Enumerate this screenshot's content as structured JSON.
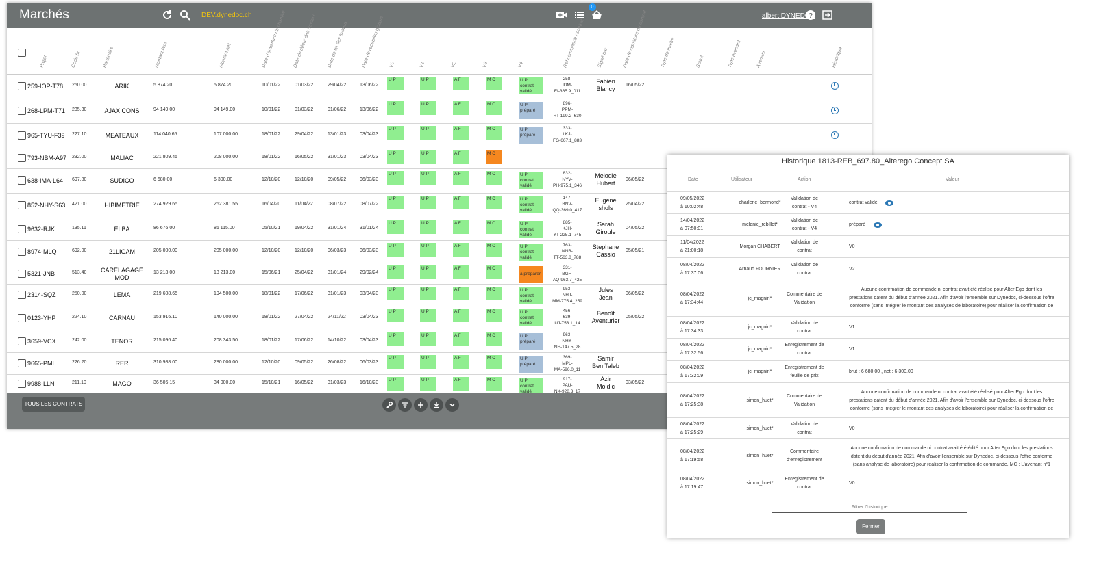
{
  "app": {
    "title": "Marchés",
    "env_link": "DEV.dynedoc.ch",
    "list_badge": "0",
    "user": "albert DYNEDOC",
    "accent_color": "#f1c40f",
    "icons": [
      "refresh-icon",
      "search-icon",
      "video-add-icon",
      "list-icon",
      "basket-icon",
      "help-icon",
      "logout-icon"
    ]
  },
  "table": {
    "columns": [
      "Projet",
      "Code bt",
      "Partenaire",
      "Montant brut",
      "Montant net",
      "Date d'ouverture du chantier",
      "Date de début des travaux",
      "Date de fin des travaux",
      "Date de réception globale",
      "V0",
      "V1",
      "V2",
      "V3",
      "V4",
      "Ref commande / contrat",
      "Signé par",
      "Date de signature du contrat",
      "Type de maître",
      "Statut",
      "Type avenant",
      "Avenant",
      "Historique"
    ],
    "rows": [
      {
        "projet": "259-IOP-T78",
        "code": "250.00",
        "partenaire": "ARIK",
        "brut": "5 874.20",
        "net": "5 874.20",
        "d1": "10/01/22",
        "d2": "01/03/22",
        "d3": "29/04/22",
        "d4": "13/06/22",
        "v0": "U P",
        "v0b": true,
        "v1": "U P",
        "v1b": false,
        "v2": "A F",
        "v3": "M C",
        "v3o": false,
        "v3b": false,
        "v4": [
          "U P",
          "contrat",
          "validé"
        ],
        "v4c": "green",
        "ref": [
          "258-",
          "IDM-",
          "EI-365.9_011"
        ],
        "signe": [
          "Fabien",
          "Blancy"
        ],
        "dsig": "16/05/22",
        "hist": true
      },
      {
        "projet": "268-LPM-T71",
        "code": "235.30",
        "partenaire": "AJAX CONS",
        "brut": "94 149.00",
        "net": "94 149.00",
        "d1": "10/01/22",
        "d2": "01/03/22",
        "d3": "01/06/22",
        "d4": "13/06/22",
        "v0": "U P",
        "v0b": true,
        "v1": "U P",
        "v1b": false,
        "v2": "A F",
        "v3": "M C",
        "v3o": false,
        "v3b": false,
        "v4": [
          "U P",
          "préparé"
        ],
        "v4c": "blue",
        "ref": [
          "896-",
          "PPM-",
          "RT-199.2_630"
        ],
        "signe": [],
        "dsig": "",
        "hist": true
      },
      {
        "projet": "965-TYU-F39",
        "code": "227.10",
        "partenaire": "MEATEAUX",
        "brut": "114 040.65",
        "net": "107 000.00",
        "d1": "18/01/22",
        "d2": "29/04/22",
        "d3": "13/01/23",
        "d4": "03/04/23",
        "v0": "U P",
        "v0b": true,
        "v1": "U P",
        "v1b": false,
        "v2": "A F",
        "v3": "M C",
        "v3o": false,
        "v3b": false,
        "v4": [
          "U P",
          "préparé"
        ],
        "v4c": "blue",
        "ref": [
          "333-",
          "LKJ-",
          "FG-667.1_883"
        ],
        "signe": [],
        "dsig": "",
        "hist": true
      },
      {
        "projet": "793-NBM-A97",
        "code": "232.00",
        "partenaire": "MALIAC",
        "brut": "221 809.45",
        "net": "208 000.00",
        "d1": "18/01/22",
        "d2": "16/05/22",
        "d3": "31/01/23",
        "d4": "03/04/23",
        "v0": "U P",
        "v0b": false,
        "v1": "U P",
        "v1b": true,
        "v2": "A F",
        "v3": "M C",
        "v3o": true,
        "v3b": true,
        "v4": [],
        "v4c": "",
        "ref": [],
        "signe": [],
        "dsig": "",
        "hist": false
      },
      {
        "projet": "638-IMA-L64",
        "code": "697.80",
        "partenaire": "SUDICO",
        "brut": "6 680.00",
        "net": "6 300.00",
        "d1": "12/10/20",
        "d2": "12/10/20",
        "d3": "09/05/22",
        "d4": "06/03/23",
        "v0": "U P",
        "v0b": true,
        "v1": "U P",
        "v1b": true,
        "v2": "A F",
        "v3": "M C",
        "v3o": false,
        "v3b": false,
        "v4": [
          "U P",
          "contrat",
          "validé"
        ],
        "v4c": "green",
        "ref": [
          "832-",
          "NYV-",
          "PH-975.1_346"
        ],
        "signe": [
          "Melodie",
          "Hubert"
        ],
        "dsig": "06/05/22",
        "hist": false
      },
      {
        "projet": "852-NHY-S63",
        "code": "421.00",
        "partenaire": "HIBIMETRIE",
        "brut": "274 929.65",
        "net": "262 381.55",
        "d1": "16/04/20",
        "d2": "11/04/22",
        "d3": "08/07/22",
        "d4": "08/07/22",
        "v0": "U P",
        "v0b": true,
        "v1": "U P",
        "v1b": true,
        "v2": "A F",
        "v3": "M C",
        "v3o": false,
        "v3b": false,
        "v4": [
          "U P",
          "contrat",
          "validé"
        ],
        "v4c": "green",
        "ref": [
          "147-",
          "BNV-",
          "QQ-369.0_417"
        ],
        "signe": [
          "Eugene",
          "shols"
        ],
        "dsig": "25/04/22",
        "hist": false
      },
      {
        "projet": "9632-RJK",
        "code": "135.11",
        "partenaire": "ELBA",
        "brut": "86 676.00",
        "net": "86 115.00",
        "d1": "05/10/21",
        "d2": "19/04/22",
        "d3": "31/01/24",
        "d4": "31/01/24",
        "v0": "U P",
        "v0b": true,
        "v1": "U P",
        "v1b": false,
        "v2": "A F",
        "v3": "M C",
        "v3o": false,
        "v3b": false,
        "v4": [
          "U P",
          "contrat",
          "validé"
        ],
        "v4c": "green",
        "ref": [
          "885-",
          "KJH-",
          "YT-225.1_745"
        ],
        "signe": [
          "Sarah",
          "Giroule"
        ],
        "dsig": "04/05/22",
        "hist": false
      },
      {
        "projet": "8974-MLQ",
        "code": "692.00",
        "partenaire": "21LIGAM",
        "brut": "205 000.00",
        "net": "205 000.00",
        "d1": "12/10/20",
        "d2": "12/10/20",
        "d3": "06/03/23",
        "d4": "06/03/23",
        "v0": "U P",
        "v0b": true,
        "v1": "U P",
        "v1b": false,
        "v2": "A F",
        "v3": "M C",
        "v3o": false,
        "v3b": false,
        "v4": [
          "U P",
          "contrat",
          "validé"
        ],
        "v4c": "green",
        "ref": [
          "763-",
          "NNB-",
          "TT-563.8_788"
        ],
        "signe": [
          "Stephane",
          "Cassio"
        ],
        "dsig": "05/05/21",
        "hist": false
      },
      {
        "projet": "5321-JNB",
        "code": "513.40",
        "partenaire": "CARELAGAGE MOD",
        "brut": "13 213.00",
        "net": "13 213.00",
        "d1": "15/06/21",
        "d2": "25/04/22",
        "d3": "31/01/24",
        "d4": "29/02/24",
        "v0": "U P",
        "v0b": true,
        "v1": "U P",
        "v1b": true,
        "v2": "A F",
        "v3": "M C",
        "v3o": false,
        "v3b": false,
        "v4": [
          "à préparer"
        ],
        "v4c": "orange",
        "ref": [
          "331-",
          "BGF-",
          "AQ-963.7_425"
        ],
        "signe": [],
        "dsig": "",
        "hist": false
      },
      {
        "projet": "2314-SQZ",
        "code": "250.00",
        "partenaire": "LEMA",
        "brut": "219 608.65",
        "net": "194 500.00",
        "d1": "18/01/22",
        "d2": "17/06/22",
        "d3": "31/01/23",
        "d4": "03/04/23",
        "v0": "U P",
        "v0b": true,
        "v1": "U P",
        "v1b": true,
        "v2": "A F",
        "v3": "M C",
        "v3o": false,
        "v3b": false,
        "v4": [
          "U P",
          "contrat",
          "validé"
        ],
        "v4c": "green",
        "ref": [
          "953-",
          "NHJ-",
          "MM-775.4_259"
        ],
        "signe": [
          "Jules",
          "Jean"
        ],
        "dsig": "06/05/22",
        "hist": false
      },
      {
        "projet": "0123-YHP",
        "code": "224.10",
        "partenaire": "CARNAU",
        "brut": "153 916.10",
        "net": "140 000.00",
        "d1": "18/01/22",
        "d2": "27/04/22",
        "d3": "24/11/22",
        "d4": "03/04/23",
        "v0": "U P",
        "v0b": true,
        "v1": "U P",
        "v1b": true,
        "v2": "A F",
        "v3": "M C",
        "v3o": false,
        "v3b": false,
        "v4": [
          "U P",
          "contrat",
          "validé"
        ],
        "v4c": "green",
        "ref": [
          "456-",
          "639-",
          "UJ-753.1_14"
        ],
        "signe": [
          "Benoît",
          "Aventurier"
        ],
        "dsig": "05/05/22",
        "hist": false
      },
      {
        "projet": "3659-VCX",
        "code": "242.00",
        "partenaire": "TENOR",
        "brut": "215 096.40",
        "net": "208 343.50",
        "d1": "18/01/22",
        "d2": "17/06/22",
        "d3": "14/10/22",
        "d4": "03/04/23",
        "v0": "U P",
        "v0b": true,
        "v1": "U P",
        "v1b": true,
        "v2": "A F",
        "v3": "M C",
        "v3o": false,
        "v3b": false,
        "v4": [
          "U P",
          "préparé"
        ],
        "v4c": "blue",
        "ref": [
          "963-",
          "NHY-",
          "NH-147.5_28"
        ],
        "signe": [],
        "dsig": "",
        "hist": false
      },
      {
        "projet": "9665-PML",
        "code": "226.20",
        "partenaire": "RER",
        "brut": "310 988.00",
        "net": "280 000.00",
        "d1": "12/10/20",
        "d2": "09/05/22",
        "d3": "26/08/22",
        "d4": "06/03/23",
        "v0": "U P",
        "v0b": true,
        "v1": "U P",
        "v1b": true,
        "v2": "A F",
        "v3": "M C",
        "v3o": false,
        "v3b": false,
        "v4": [
          "U P",
          "préparé"
        ],
        "v4c": "blue",
        "ref": [
          "369-",
          "MPL-",
          "MA-596.0_11"
        ],
        "signe": [
          "Samir",
          "Ben Taleb"
        ],
        "dsig": "",
        "hist": false
      },
      {
        "projet": "9988-LLN",
        "code": "211.10",
        "partenaire": "MAGO",
        "brut": "36 506.15",
        "net": "34 000.00",
        "d1": "15/10/21",
        "d2": "16/05/22",
        "d3": "31/03/23",
        "d4": "16/10/23",
        "v0": "U P",
        "v0b": true,
        "v1": "U P",
        "v1b": false,
        "v2": "A F",
        "v3": "M C",
        "v3o": false,
        "v3b": false,
        "v4": [
          "U P",
          "contrat",
          "validé"
        ],
        "v4c": "green",
        "ref": [
          "917-",
          "PAU-",
          "NX-928.3_17"
        ],
        "signe": [
          "Azir",
          "Moldic"
        ],
        "dsig": "03/05/22",
        "hist": false
      }
    ]
  },
  "footer": {
    "all_contracts": "TOUS LES CONTRATS",
    "fabs": [
      "wrench-icon",
      "filter-icon",
      "plus-icon",
      "download-icon",
      "chevron-down-icon"
    ]
  },
  "history": {
    "title": "Historique 1813-REB_697.80_Alterego Concept SA",
    "headers": {
      "date": "Date",
      "user": "Utilisateur",
      "action": "Action",
      "value": "Valeur"
    },
    "rows": [
      {
        "date": [
          "09/05/2022",
          "à 10:02:48"
        ],
        "user": "charlene_bermond*",
        "action": [
          "Validation de",
          "contrat - V4"
        ],
        "value": [
          "contrat validé"
        ],
        "eye": true,
        "long": false
      },
      {
        "date": [
          "14/04/2022",
          "à 07:50:01"
        ],
        "user": "melanie_rebillot*",
        "action": [
          "Validation de",
          "contrat - V4"
        ],
        "value": [
          "préparé"
        ],
        "eye": true,
        "long": false
      },
      {
        "date": [
          "11/04/2022",
          "à 21:00:18"
        ],
        "user": "Morgan CHABERT",
        "action": [
          "Validation de",
          "contrat"
        ],
        "value": [
          "V0"
        ],
        "eye": false,
        "long": false
      },
      {
        "date": [
          "08/04/2022",
          "à 17:37:06"
        ],
        "user": "Arnaud FOURNIER",
        "action": [
          "Validation de",
          "contrat"
        ],
        "value": [
          "V2"
        ],
        "eye": false,
        "long": false
      },
      {
        "date": [
          "08/04/2022",
          "à 17:34:44"
        ],
        "user": "jc_magnin*",
        "action": [
          "Commentaire de",
          "Validation"
        ],
        "value": [
          "Aucune confirmation de commande ni contrat avait été réalisé pour Alter Ego dont les",
          "prestations datent du début d'année 2021. Afin d'avoir l'ensemble sur Dynedoc, ci-dessous l'offre",
          "conforme (sans intégrer le montant des analyses de laboratoire) pour réaliser la confirmation de"
        ],
        "eye": false,
        "long": true
      },
      {
        "date": [
          "08/04/2022",
          "à 17:34:33"
        ],
        "user": "jc_magnin*",
        "action": [
          "Validation de",
          "contrat"
        ],
        "value": [
          "V1"
        ],
        "eye": false,
        "long": false
      },
      {
        "date": [
          "08/04/2022",
          "à 17:32:56"
        ],
        "user": "jc_magnin*",
        "action": [
          "Enregistrement de",
          "contrat"
        ],
        "value": [
          "V1"
        ],
        "eye": false,
        "long": false
      },
      {
        "date": [
          "08/04/2022",
          "à 17:32:09"
        ],
        "user": "jc_magnin*",
        "action": [
          "Enregistrement de",
          "feuille de prix"
        ],
        "value": [
          "brut : 6 680.00 , net : 6 300.00"
        ],
        "eye": false,
        "long": false
      },
      {
        "date": [
          "08/04/2022",
          "à 17:25:38"
        ],
        "user": "simon_huet*",
        "action": [
          "Commentaire de",
          "Validation"
        ],
        "value": [
          "Aucune confirmation de commande ni contrat avait été réalisé pour Alter Ego dont les",
          "prestations datent du début d'année 2021. Afin d'avoir l'ensemble sur Dynedoc, ci-dessous l'offre",
          "conforme (sans intégrer le montant des analyses de laboratoire) pour réaliser la confirmation de"
        ],
        "eye": false,
        "long": true
      },
      {
        "date": [
          "08/04/2022",
          "à 17:25:29"
        ],
        "user": "simon_huet*",
        "action": [
          "Validation de",
          "contrat"
        ],
        "value": [
          "V0"
        ],
        "eye": false,
        "long": false
      },
      {
        "date": [
          "08/04/2022",
          "à 17:19:58"
        ],
        "user": "simon_huet*",
        "action": [
          "Commentaire",
          "d'enregistrement"
        ],
        "value": [
          "Aucune confirmation de commande ni contrat avait été édité pour Alter Ego dont les prestations",
          "datent du début d'année 2021. Afin d'avoir l'ensemble sur Dynedoc, ci-dessous l'offre conforme",
          "(sans analyse de laboratoire) pour réaliser la confirmation de commande. MC : L'avenant n°1"
        ],
        "eye": false,
        "long": true
      },
      {
        "date": [
          "08/04/2022",
          "à 17:19:47"
        ],
        "user": "simon_huet*",
        "action": [
          "Enregistrement de",
          "contrat"
        ],
        "value": [
          "V0"
        ],
        "eye": false,
        "long": false
      }
    ],
    "filter_placeholder": "Filtrer l'historique",
    "close_label": "Fermer"
  }
}
